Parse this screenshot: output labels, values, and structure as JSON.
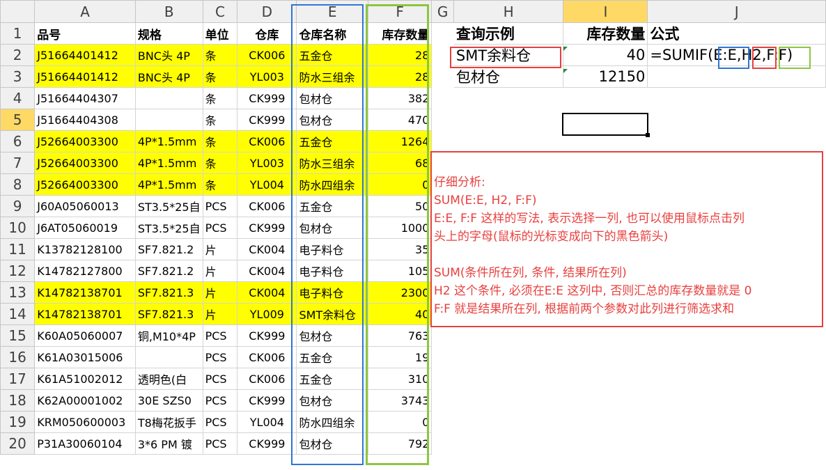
{
  "columns": [
    "A",
    "B",
    "C",
    "D",
    "E",
    "F",
    "G",
    "H",
    "I",
    "J"
  ],
  "rows": [
    {
      "n": "1",
      "A": "品号",
      "B": "规格",
      "C": "单位",
      "D": "仓库",
      "E": "仓库名称",
      "F": "库存数量",
      "H": "查询示例",
      "I": "库存数量",
      "J": "公式",
      "hl": false
    },
    {
      "n": "2",
      "A": "J51664401412",
      "B": "BNC头 4P",
      "C": "条",
      "D": "CK006",
      "E": "五金仓",
      "F": "28",
      "H": "SMT余料仓",
      "I": "40",
      "J": "=SUMIF(E:E,H2,F:F)",
      "hl": true
    },
    {
      "n": "3",
      "A": "J51664401412",
      "B": "BNC头 4P",
      "C": "条",
      "D": "YL003",
      "E": "防水三组余",
      "F": "28",
      "H": "包材仓",
      "I": "12150",
      "J": "",
      "hl": true
    },
    {
      "n": "4",
      "A": "J51664404307",
      "B": "",
      "C": "条",
      "D": "CK999",
      "E": "包材仓",
      "F": "382",
      "H": "",
      "I": "",
      "J": "",
      "hl": false
    },
    {
      "n": "5",
      "A": "J51664404308",
      "B": "",
      "C": "条",
      "D": "CK999",
      "E": "包材仓",
      "F": "470",
      "H": "",
      "I": "",
      "J": "",
      "hl": false
    },
    {
      "n": "6",
      "A": "J52664003300",
      "B": "4P*1.5mm",
      "C": "条",
      "D": "CK006",
      "E": "五金仓",
      "F": "1264",
      "H": "",
      "I": "",
      "J": "",
      "hl": true
    },
    {
      "n": "7",
      "A": "J52664003300",
      "B": "4P*1.5mm",
      "C": "条",
      "D": "YL003",
      "E": "防水三组余",
      "F": "68",
      "H": "",
      "I": "",
      "J": "",
      "hl": true
    },
    {
      "n": "8",
      "A": "J52664003300",
      "B": "4P*1.5mm",
      "C": "条",
      "D": "YL004",
      "E": "防水四组余",
      "F": "0",
      "H": "",
      "I": "",
      "J": "",
      "hl": true
    },
    {
      "n": "9",
      "A": "J60A05060013",
      "B": "ST3.5*25自",
      "C": "PCS",
      "D": "CK006",
      "E": "五金仓",
      "F": "50",
      "H": "",
      "I": "",
      "J": "",
      "hl": false
    },
    {
      "n": "10",
      "A": "J6AT05060019",
      "B": "ST3.5*25自",
      "C": "PCS",
      "D": "CK999",
      "E": "包材仓",
      "F": "1000",
      "H": "",
      "I": "",
      "J": "",
      "hl": false
    },
    {
      "n": "11",
      "A": "K13782128100",
      "B": "SF7.821.2",
      "C": "片",
      "D": "CK004",
      "E": "电子料仓",
      "F": "35",
      "H": "",
      "I": "",
      "J": "",
      "hl": false
    },
    {
      "n": "12",
      "A": "K14782127800",
      "B": "SF7.821.2",
      "C": "片",
      "D": "CK004",
      "E": "电子料仓",
      "F": "105",
      "H": "",
      "I": "",
      "J": "",
      "hl": false
    },
    {
      "n": "13",
      "A": "K14782138701",
      "B": "SF7.821.3",
      "C": "片",
      "D": "CK004",
      "E": "电子料仓",
      "F": "2300",
      "H": "",
      "I": "",
      "J": "",
      "hl": true
    },
    {
      "n": "14",
      "A": "K14782138701",
      "B": "SF7.821.3",
      "C": "片",
      "D": "YL009",
      "E": "SMT余料仓",
      "F": "40",
      "H": "",
      "I": "",
      "J": "",
      "hl": true
    },
    {
      "n": "15",
      "A": "K60A05060007",
      "B": "铜,M10*4P",
      "C": "PCS",
      "D": "CK999",
      "E": "包材仓",
      "F": "763",
      "H": "",
      "I": "",
      "J": "",
      "hl": false
    },
    {
      "n": "16",
      "A": "K61A03015006",
      "B": "",
      "C": "PCS",
      "D": "CK006",
      "E": "五金仓",
      "F": "19",
      "H": "",
      "I": "",
      "J": "",
      "hl": false
    },
    {
      "n": "17",
      "A": "K61A51002012",
      "B": "透明色(白",
      "C": "PCS",
      "D": "CK006",
      "E": "五金仓",
      "F": "310",
      "H": "",
      "I": "",
      "J": "",
      "hl": false
    },
    {
      "n": "18",
      "A": "K62A00001002",
      "B": "30E SZS0",
      "C": "PCS",
      "D": "CK999",
      "E": "包材仓",
      "F": "3743",
      "H": "",
      "I": "",
      "J": "",
      "hl": false
    },
    {
      "n": "19",
      "A": "KRM050600003",
      "B": "T8梅花扳手",
      "C": "PCS",
      "D": "YL004",
      "E": "防水四组余",
      "F": "0",
      "H": "",
      "I": "",
      "J": "",
      "hl": false
    },
    {
      "n": "20",
      "A": "P31A30060104",
      "B": "3*6 PM 镀",
      "C": "PCS",
      "D": "CK999",
      "E": "包材仓",
      "F": "792",
      "H": "",
      "I": "",
      "J": "",
      "hl": false
    }
  ],
  "note": {
    "lines": [
      "仔细分析:",
      "SUM(E:E, H2, F:F)",
      "E:E, F:F 这样的写法, 表示选择一列, 也可以使用鼠标点击列",
      "头上的字母(鼠标的光标变成向下的黑色箭头)",
      "",
      "SUM(条件所在列, 条件, 结果所在列)",
      "H2 这个条件, 必须在E:E 这列中, 否则汇总的库存数量就是 0",
      "F:F 就是结果所在列, 根据前两个参数对此列进行筛选求和"
    ]
  },
  "colors": {
    "highlight": "#ffff00",
    "red": "#e8403e",
    "blue": "#2e75d6",
    "green": "#8dc63f",
    "selected_header": "#ffd966"
  }
}
